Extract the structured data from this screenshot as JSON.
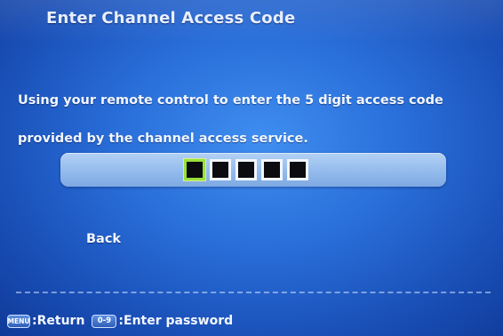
{
  "title": "Enter Channel Access Code",
  "instructions": {
    "line1": "Using your remote control to enter the 5 digit access code",
    "line2": "provided by the channel access service."
  },
  "code_entry": {
    "length": 5,
    "active_index": 0
  },
  "back_label": "Back",
  "footer": {
    "return_key": "MENU",
    "return_label": ":Return",
    "password_key": "0-9",
    "password_label": ":Enter password"
  },
  "colors": {
    "background": "#2a6fda",
    "code_bar": "#93bbec",
    "active_digit_border": "#9be03a"
  }
}
